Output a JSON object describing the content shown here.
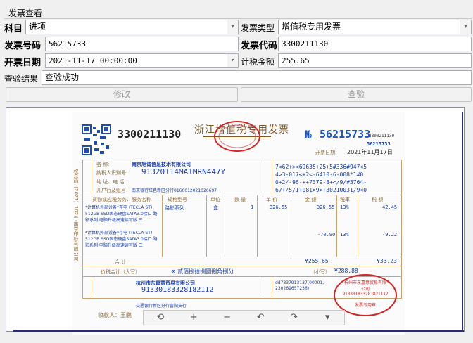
{
  "group_title": "发票查看",
  "form": {
    "subject_label": "科目",
    "subject_value": "进项",
    "invoice_type_label": "发票类型",
    "invoice_type_value": "增值税专用发票",
    "invoice_no_label": "发票号码",
    "invoice_no_value": "56215733",
    "invoice_code_label": "发票代码",
    "invoice_code_value": "3300211130",
    "invoice_date_label": "开票日期",
    "invoice_date_value": "2021-11-17 00:00:00",
    "tax_amount_label": "计税金额",
    "tax_amount_value": "255.65",
    "result_label": "查验结果",
    "result_value": "查验成功"
  },
  "buttons": {
    "edit": "修改",
    "verify": "查验"
  },
  "invoice": {
    "code": "3300211130",
    "title": "浙江增值税专用发票",
    "no_symbol": "№",
    "number": "56215733",
    "code_small": "3300211130",
    "number_small": "56215733",
    "date_label": "开票日期:",
    "date": "2021年11月17日",
    "buyer_name_label": "名 称:",
    "buyer_name": "南京旭谐信息技术有限公司",
    "buyer_taxid_label": "纳税人识别号:",
    "buyer_taxid": "91320114MA1MRN447Y",
    "buyer_addr_label": "地 址、电 话:",
    "buyer_bank_label": "开户行及账号:",
    "buyer_bank": "南京银行红色新区分行0160012021026697",
    "cipher_lines": [
      "7<62+><69635+25+5#336#947<5",
      "4>3-017<+2<-6410-6-008*1#0",
      "0+2/-96-++7379-8+</9/#3764-",
      "67+/5/1+081>9>+30210031/9<0"
    ],
    "col_goods": "货物或应税劳务、服务名称",
    "col_spec": "规格型号",
    "col_unit": "单位",
    "col_qty": "数 量",
    "col_price": "单 价",
    "col_amount": "金 额",
    "col_rate": "税率",
    "col_tax": "税 额",
    "row1_name": "*计算机外部设备*存电 (TECLA ST) 512GB SSD固态硬盘SATA3.0接口 路影系列 电脑升级高速读写版 三",
    "row1_spec": "路影系列",
    "row1_unit": "盒",
    "row1_qty": "1",
    "row1_price": "326.55",
    "row1_amount": "326.55",
    "row1_rate": "13%",
    "row1_tax": "42.45",
    "row2_name": "*计算机外部设备*存电 (TECLA ST) 512GB SSD固态硬盘SATA3.0接口 路影系列 电脑升级高速读写版 三",
    "row2_amount": "-70.90",
    "row2_rate": "13%",
    "row2_tax": "-9.22",
    "sum_label": "合 计",
    "sum_amount": "¥255.65",
    "sum_tax": "¥33.23",
    "total_label": "价税合计（大写）",
    "total_words": "⊗ 贰佰捌拾捌圆捌角捌分",
    "total_small_label": "（小写）",
    "total_small": "¥288.88",
    "seller_name": "杭州市东嘉意贸易有限公司",
    "seller_taxid": "91330183328182112",
    "seller_bank": "交通银行新区分行富阳支行",
    "seller_remark": "dd7337913137(00001, 230269657236)",
    "payee_label": "收款人：王鹏",
    "side_text": "税总函〔2021〕102号 南京印钞有限公司",
    "stamp_text": "杭州市东嘉意贸易有限公司",
    "stamp_id": "913301833281821112",
    "stamp_bottom": "发票专用章"
  },
  "toolbar": {
    "icons": [
      "rotate-icon",
      "zoom-in-icon",
      "zoom-out-icon",
      "undo-icon",
      "redo-icon",
      "dropdown-icon"
    ],
    "glyphs": [
      "⟲",
      "+",
      "−",
      "↶",
      "↷",
      "▾"
    ]
  }
}
